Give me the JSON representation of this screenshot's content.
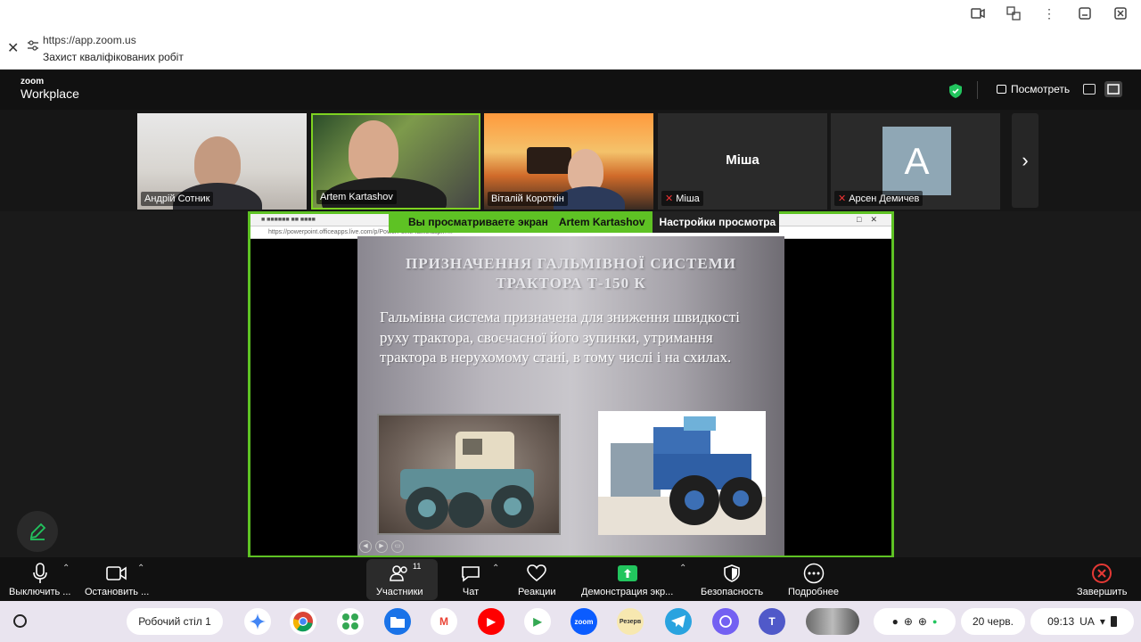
{
  "browser": {
    "url": "https://app.zoom.us",
    "page_title": "Захист кваліфікованих робіт",
    "icons": [
      "camera-icon",
      "translate-icon",
      "more-vert-icon",
      "minimize-icon",
      "close-icon"
    ]
  },
  "zoom": {
    "logo_top": "zoom",
    "logo_bottom": "Workplace",
    "view_label": "Посмотреть"
  },
  "participants": [
    {
      "name": "Андрій Сотник",
      "muted": false
    },
    {
      "name": "Artem Kartashov",
      "muted": false,
      "active_speaker": true
    },
    {
      "name": "Віталій Короткін",
      "muted": false
    },
    {
      "name": "Міша",
      "muted": true,
      "center_label": "Міша"
    },
    {
      "name": "Арсен Демичев",
      "muted": true,
      "avatar_letter": "A"
    }
  ],
  "share": {
    "viewing_prefix": "Вы просматриваете экран",
    "presenter": "Artem Kartashov",
    "view_settings": "Настройки просмотра",
    "border_color": "#5ec224",
    "address": "https://powerpoint.officeapps.live.com/p/PowerPointFrame.aspx?..."
  },
  "slide": {
    "title_line1": "ПРИЗНАЧЕННЯ ГАЛЬМІВНОЇ СИСТЕМИ",
    "title_line2": "ТРАКТОРА Т-150 К",
    "body": "Гальмівна система призначена для зниження швидкості руху трактора, своєчасної його зупинки, утримання трактора в нерухомому стані, в тому числі і на схилах."
  },
  "toolbar": {
    "mute": "Выключить ...",
    "video": "Остановить ...",
    "participants": "Участники",
    "participants_count": "11",
    "chat": "Чат",
    "reactions": "Реакции",
    "share": "Демонстрация экр...",
    "security": "Безопасность",
    "more": "Подробнее",
    "end": "Завершить"
  },
  "shelf": {
    "desk": "Робочий стіл 1",
    "date": "20 черв.",
    "time": "09:13",
    "lang": "UA",
    "apps": [
      "gemini",
      "chrome",
      "apps",
      "files",
      "gmail",
      "youtube",
      "play-store",
      "zoom",
      "keep",
      "telegram",
      "viber",
      "teams",
      "photos"
    ],
    "zoom_app_label": "zoom",
    "keep_app_label": "Резерв"
  }
}
